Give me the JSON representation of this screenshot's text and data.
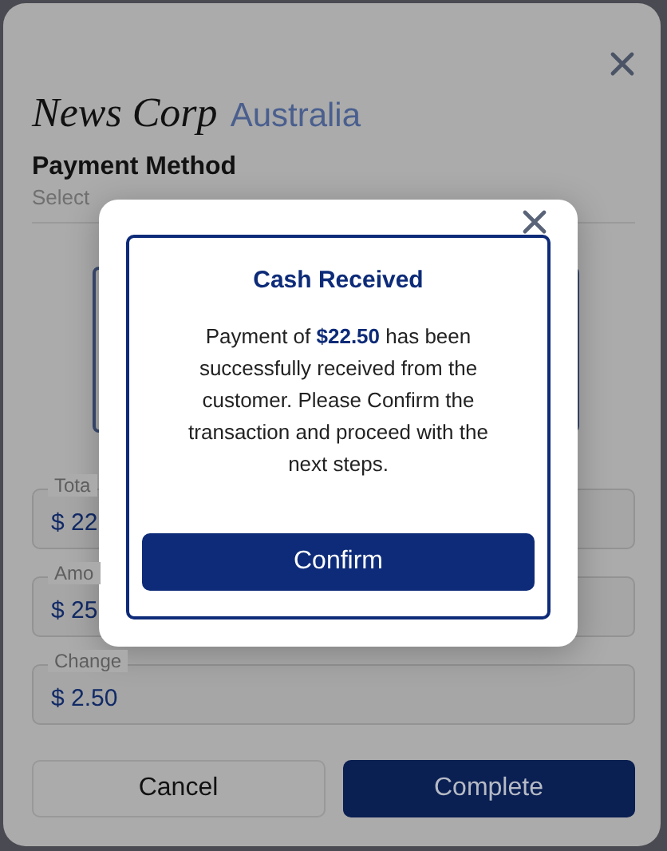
{
  "dialog": {
    "logo": {
      "wordmark": "News Corp",
      "region": "Australia"
    },
    "title": "Payment Method",
    "subtitle": "Select",
    "fields": [
      {
        "label": "Tota",
        "value": "$ 22"
      },
      {
        "label": "Amo",
        "value": "$ 25"
      },
      {
        "label": "Change",
        "value": "$ 2.50"
      }
    ],
    "buttons": [
      {
        "label": "Cancel",
        "kind": "secondary"
      },
      {
        "label": "Complete",
        "kind": "primary"
      }
    ]
  },
  "modal": {
    "title": "Cash Received",
    "message": "Payment of **$22.50** has been successfully received from the customer. Please Confirm the transaction and proceed with the next steps.",
    "button": "Confirm"
  }
}
